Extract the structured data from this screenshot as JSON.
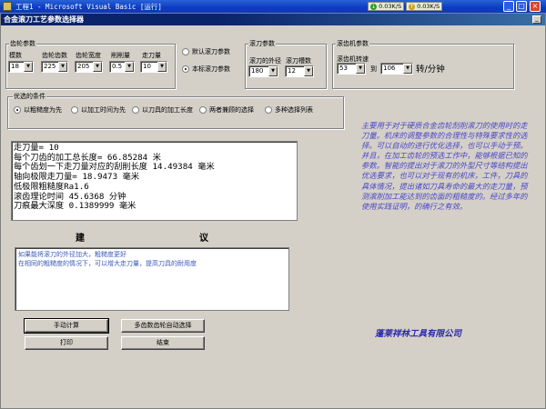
{
  "window": {
    "title": "工程1 - Microsoft Visual Basic [运行]",
    "net_down": "0.03K/S",
    "net_up": "0.03K/S",
    "minimize": "_",
    "maximize": "□",
    "close": "×"
  },
  "form": {
    "title": "合金滚刀工艺参数选择器",
    "minimize": "_"
  },
  "gear_params": {
    "title": "齿轮参数",
    "module_label": "模数",
    "module_value": "18",
    "teeth_label": "齿轮齿数",
    "teeth_value": "225",
    "width_label": "齿轮宽度",
    "width_value": "205",
    "cut_label": "削削量",
    "cut_value": "0.5",
    "feed_label": "走刀量",
    "feed_value": "10"
  },
  "hob_type": {
    "default_label": "默认滚刀参数",
    "standard_label": "本标滚刀参数"
  },
  "hob_params": {
    "title": "滚刀参数",
    "diameter_label": "滚刀的外径",
    "diameter_value": "180",
    "slots_label": "滚刀槽数",
    "slots_value": "12"
  },
  "machine_params": {
    "title": "滚齿机参数",
    "speed_label": "滚齿机转速",
    "range_from": "53",
    "range_to_label": "到",
    "range_to": "106",
    "unit": "转/分钟"
  },
  "priority": {
    "title": "优选的条件",
    "options": [
      "以粗糙度为先",
      "以加工时间为先",
      "以刀具的加工长度",
      "两者兼顾的选择",
      "多种选择列表"
    ]
  },
  "results": [
    "走刀量= 10",
    "每个刀齿的加工总长度= 66.85284 米",
    "每个齿划一下走刀量对应的刮削长度 14.49384 毫米",
    "轴向极限走刀量= 18.9473 毫米",
    "低极限粗糙度Ra1.6",
    "滚齿理论时间 45.6368 分钟",
    "刀痕最大深度 0.1389999 毫米"
  ],
  "advice": {
    "heading_left": "建",
    "heading_right": "议",
    "lines": [
      "如果能将滚刀的外径加大，粗糙度更好",
      "在相同的粗糙度的情况下，可以增大走刀量，提高刀具的耐用度"
    ]
  },
  "buttons": {
    "manual_calc": "手动计算",
    "auto_select": "多齿数齿轮自动选择",
    "print": "打印",
    "exit": "结束"
  },
  "description": "主要用于对于硬质合金齿轮刮削滚刀的使用时的走刀量。机床的调整参数的合理性与特殊要求性的选择。可以自动的进行优化选择，也可以手动于预。并且，在加工齿轮的预选工作中，能够根据已知的参数。智能的提出对于滚刀的外型尺寸等结构提出优选要求，也可以对于现有的机床，工件，刀具的具体情况，提出诸如刀具寿命的最大的走刀量，预测滚削加工能达到的齿面的粗糙度的。经过多年的使用实践证明，的确行之有效。",
  "company": "蓬莱祥林工具有限公司",
  "colors": {
    "desktop": "#3a6ea5",
    "form_bg": "#d4d0c8",
    "title_blue": "#0a246a",
    "desc_text": "#4a46c8",
    "advice_text": "#3c5ab8"
  }
}
